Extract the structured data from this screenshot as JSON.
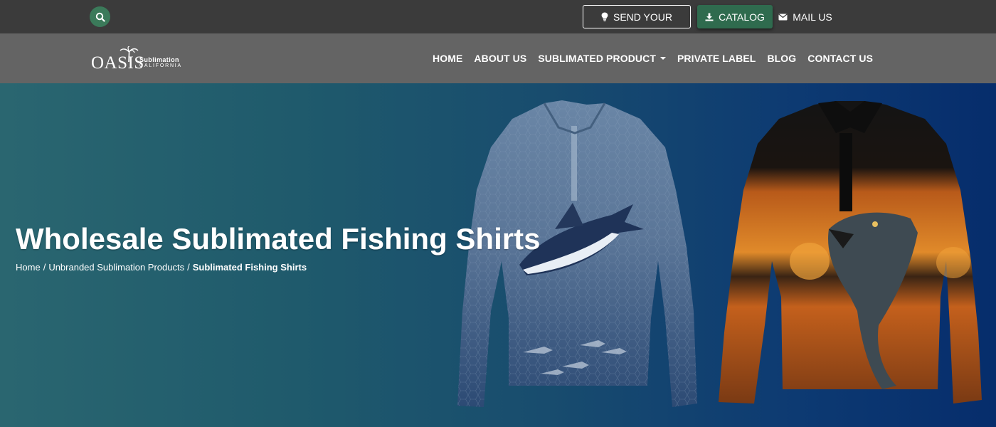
{
  "topbar": {
    "send_label": "SEND YOUR",
    "catalog_label": "CATALOG",
    "mail_label": "MAIL US",
    "icons": {
      "search": "search-icon",
      "send": "lightbulb-icon",
      "catalog": "download-icon",
      "mail": "envelope-icon"
    }
  },
  "logo": {
    "main": "OASIS",
    "sub1": "Sublimation",
    "sub2": "CALIFORNIA"
  },
  "nav": {
    "items": [
      {
        "label": "HOME"
      },
      {
        "label": "ABOUT US"
      },
      {
        "label": "SUBLIMATED PRODUCT"
      },
      {
        "label": "PRIVATE LABEL"
      },
      {
        "label": "BLOG"
      },
      {
        "label": "CONTACT US"
      }
    ]
  },
  "hero": {
    "title": "Wholesale Sublimated Fishing Shirts",
    "breadcrumb": {
      "home": "Home",
      "sep1": "/",
      "category": "Unbranded Sublimation Products",
      "sep2": "/",
      "current": "Sublimated Fishing Shirts"
    }
  },
  "colors": {
    "topbar": "#3b3b3b",
    "navbar": "#646464",
    "accent_green": "#2f6b4e",
    "hero_left": "#2a6670",
    "hero_right": "#062d6c"
  }
}
